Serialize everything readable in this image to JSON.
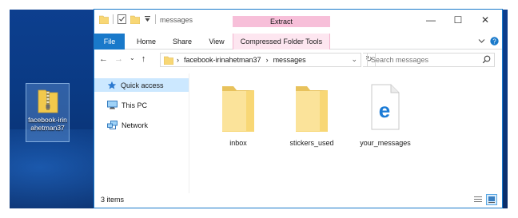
{
  "desktop": {
    "icon_label": "facebook-irinahetman37"
  },
  "window": {
    "title": "messages",
    "context_group": "Extract",
    "minimize": "—",
    "maximize": "☐",
    "close": "✕"
  },
  "ribbon": {
    "tabs": [
      "File",
      "Home",
      "Share",
      "View",
      "Compressed Folder Tools"
    ]
  },
  "address": {
    "crumbs": [
      "facebook-irinahetman37",
      "messages"
    ],
    "separator": "›",
    "search_placeholder": "Search messages"
  },
  "nav": {
    "items": [
      {
        "label": "Quick access",
        "icon": "star-icon",
        "selected": true
      },
      {
        "label": "This PC",
        "icon": "computer-icon"
      },
      {
        "label": "Network",
        "icon": "network-icon"
      }
    ]
  },
  "content": {
    "items": [
      {
        "label": "inbox",
        "icon": "folder-icon"
      },
      {
        "label": "stickers_used",
        "icon": "folder-icon"
      },
      {
        "label": "your_messages",
        "icon": "edge-html-icon"
      }
    ]
  },
  "status": {
    "count": "3 items"
  },
  "colors": {
    "accent": "#1979ca",
    "context_pink": "#f7bfd9",
    "selection": "#cce8ff",
    "folder": "#f8d775"
  }
}
